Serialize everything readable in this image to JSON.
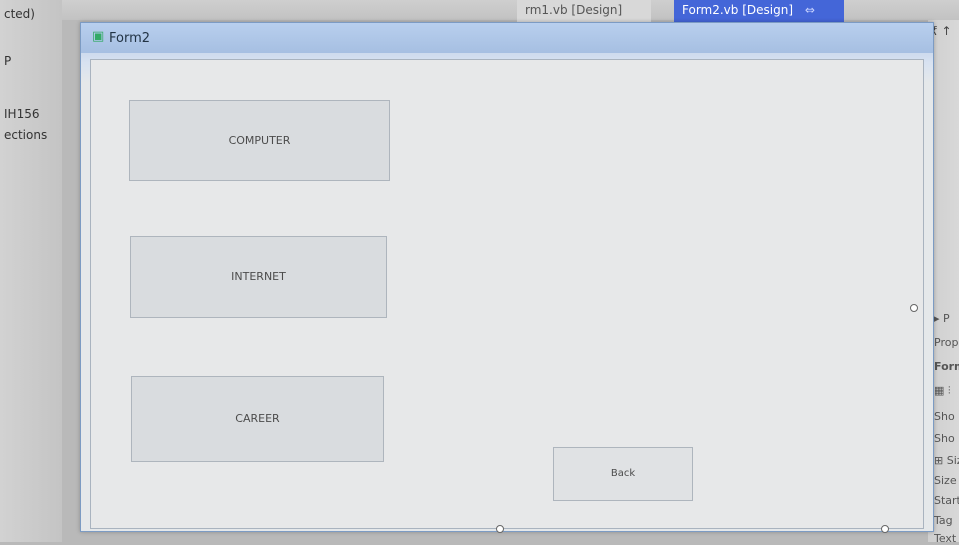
{
  "ide": {
    "tabs": [
      {
        "label": "rm1.vb [Design]"
      },
      {
        "label": "Form2.vb [Design]"
      }
    ],
    "tab_pin": "⇔",
    "tab_close": "×",
    "corner_glyph": "₹ ↑",
    "left_panel": [
      "cted)",
      "P",
      "IH156",
      "ections"
    ],
    "right_panel": [
      "▸ P",
      "Prop",
      "Form",
      "▦ ⫶",
      "Sho",
      "Sho",
      "⊞ Size",
      "Size",
      "Start",
      "Tag",
      "Text"
    ]
  },
  "form": {
    "title": "Form2",
    "buttons": {
      "computer": "COMPUTER",
      "internet": "INTERNET",
      "career": "CAREER",
      "back": "Back"
    },
    "window_controls": {
      "minimize": "—",
      "maximize": "▭",
      "close": "✕"
    }
  }
}
